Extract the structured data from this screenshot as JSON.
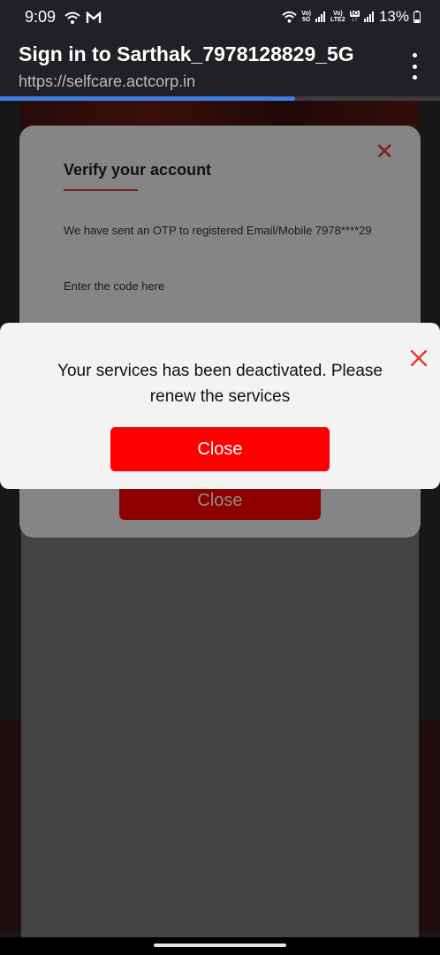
{
  "status_bar": {
    "time": "9:09",
    "net1_top": "Vo)",
    "net1_bottom": "5G",
    "net2_top": "Vo)",
    "net2_bottom": "LTE2",
    "net2_badge": "5G",
    "battery": "13%",
    "icons": [
      "wifi-icon",
      "gmail-icon",
      "wifi-icon",
      "signal-icon",
      "signal-icon",
      "battery-icon"
    ]
  },
  "browser": {
    "title": "Sign in to Sarthak_7978128829_5G",
    "url": "https://selfcare.actcorp.in",
    "progress_fraction": 0.67
  },
  "verify_modal": {
    "title": "Verify your account",
    "message": "We have sent an OTP to registered Email/Mobile 7978****29",
    "enter_code": "Enter the code here",
    "close_label": "Close"
  },
  "alert_modal": {
    "message": "Your services has been deactivated. Please renew the services",
    "close_label": "Close",
    "accent_color": "#ff0000"
  }
}
